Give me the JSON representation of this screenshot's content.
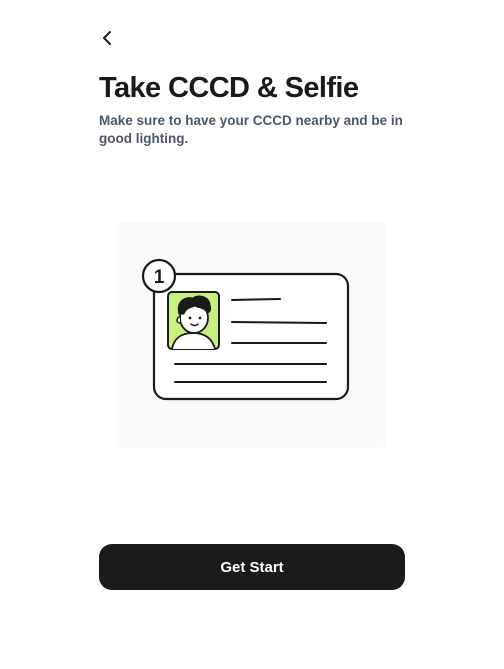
{
  "header": {
    "back_icon": "chevron-left-icon",
    "title": "Take CCCD & Selfie",
    "subtitle": "Make sure to have your CCCD nearby and be in good lighting."
  },
  "illustration": {
    "step_number": "1",
    "accent_color": "#c9f07e",
    "icon": "id-card-illustration"
  },
  "actions": {
    "primary_label": "Get Start"
  }
}
